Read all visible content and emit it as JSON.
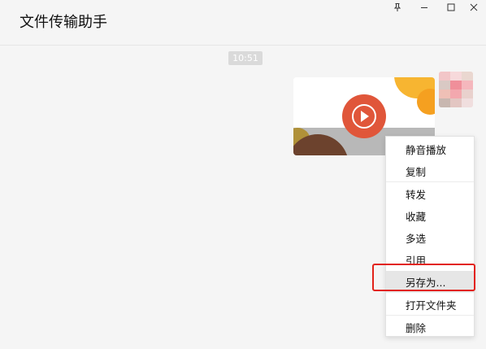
{
  "window": {
    "title": "文件传输助手",
    "controls": [
      "pin-icon",
      "minimize-icon",
      "maximize-icon",
      "close-icon"
    ]
  },
  "chat": {
    "timestamp": "10:51",
    "message": {
      "type": "video",
      "thumbnail_icon": "play-icon"
    },
    "avatar": "avatar"
  },
  "context_menu": {
    "items": [
      {
        "label": "静音播放"
      },
      {
        "label": "复制"
      },
      {
        "label": "转发"
      },
      {
        "label": "收藏"
      },
      {
        "label": "多选"
      },
      {
        "label": "引用"
      },
      {
        "label": "另存为..."
      },
      {
        "label": "打开文件夹"
      },
      {
        "label": "删除"
      }
    ],
    "highlighted_item": "另存为...",
    "highlight_color": "#e2231a"
  },
  "colors": {
    "background": "#f5f5f5",
    "play_button": "#e0563a",
    "highlight_border": "#e2231a"
  }
}
